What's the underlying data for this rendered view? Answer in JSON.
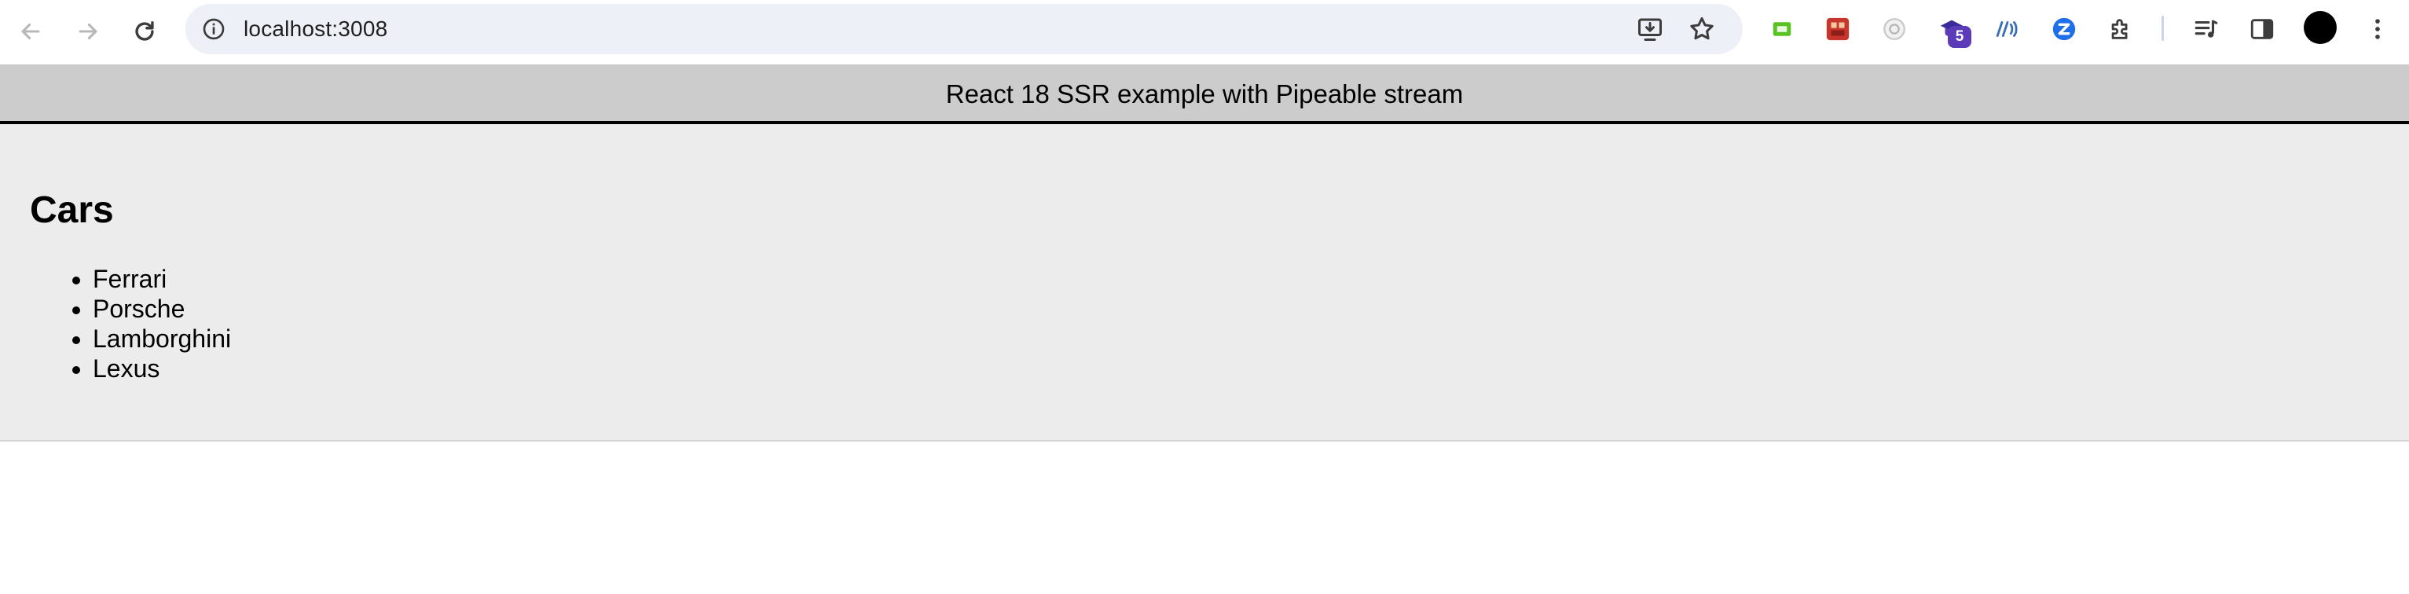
{
  "browser": {
    "url": "localhost:3008",
    "extension_badge": "5",
    "icons": {
      "back": "back-arrow-icon",
      "forward": "forward-arrow-icon",
      "reload": "reload-icon",
      "site_info": "site-info-icon",
      "install": "install-app-icon",
      "bookmark": "star-icon",
      "extensions": "puzzle-icon",
      "media": "media-controls-icon",
      "side_panel": "side-panel-icon",
      "menu": "kebab-menu-icon"
    },
    "colors": {
      "omnibox_bg": "#edf0f6",
      "badge": "#5b3bb7"
    }
  },
  "page": {
    "header_text": "React 18 SSR example with Pipeable stream",
    "heading": "Cars",
    "cars": [
      "Ferrari",
      "Porsche",
      "Lamborghini",
      "Lexus"
    ],
    "colors": {
      "header_bg": "#cccccc",
      "content_bg": "#ececec"
    }
  }
}
